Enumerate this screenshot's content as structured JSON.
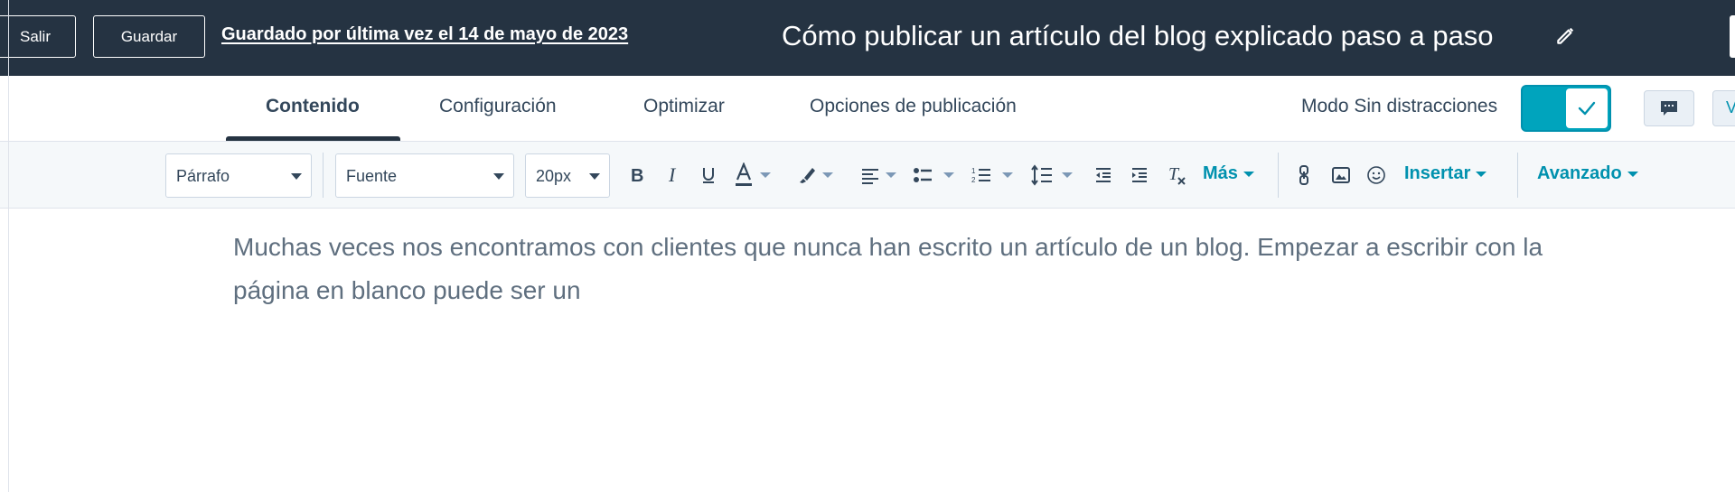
{
  "topbar": {
    "exit_label": "Salir",
    "save_label": "Guardar",
    "last_saved": "Guardado por última vez el 14 de mayo de 2023",
    "title": "Cómo publicar un artículo del blog explicado paso a paso",
    "edit_icon": "pencil-icon"
  },
  "tabs": [
    {
      "label": "Contenido",
      "active": true
    },
    {
      "label": "Configuración",
      "active": false
    },
    {
      "label": "Optimizar",
      "active": false
    },
    {
      "label": "Opciones de publicación",
      "active": false
    }
  ],
  "focus_mode": {
    "label": "Modo Sin distracciones",
    "enabled": true
  },
  "header_right": {
    "comment_icon": "comment-icon",
    "partial_button": "V"
  },
  "toolbar": {
    "paragraph_select": "Párrafo",
    "font_select": "Fuente",
    "size_select": "20px",
    "more_label": "Más",
    "insert_label": "Insertar",
    "advanced_label": "Avanzado",
    "icons": [
      "bold-icon",
      "italic-icon",
      "underline-icon",
      "text-color-icon",
      "highlight-icon",
      "align-icon",
      "bulleted-list-icon",
      "numbered-list-icon",
      "line-height-icon",
      "outdent-icon",
      "indent-icon",
      "clear-format-icon",
      "link-icon",
      "image-icon",
      "emoji-icon"
    ]
  },
  "editor": {
    "body_text": "Muchas veces nos encontramos con clientes que nunca han escrito un artículo de un blog. Empezar a escribir con la página en blanco puede ser un"
  },
  "colors": {
    "topbar_bg": "#253342",
    "accent": "#00a4bd",
    "link_teal": "#0091ae",
    "text_dark": "#33475b"
  }
}
